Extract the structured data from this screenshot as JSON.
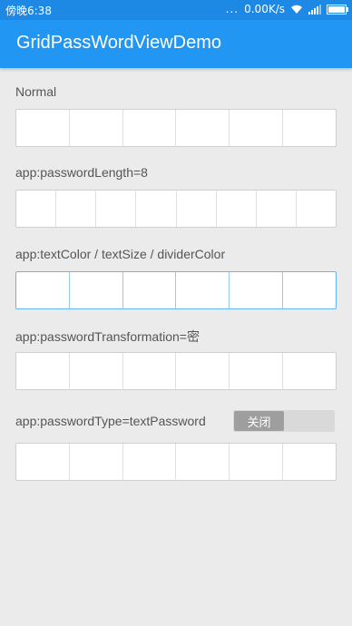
{
  "status_bar": {
    "time": "傍晚6:38",
    "dots": "...",
    "network_speed": "0.00K/s"
  },
  "app_bar": {
    "title": "GridPassWordViewDemo"
  },
  "sections": [
    {
      "label": "Normal",
      "cells": 6
    },
    {
      "label": "app:passwordLength=8",
      "cells": 8
    },
    {
      "label": "app:textColor / textSize / dividerColor",
      "cells": 6
    },
    {
      "label": "app:passwordTransformation=密",
      "cells": 6
    },
    {
      "label": "app:passwordType=textPassword",
      "cells": 6
    }
  ],
  "toggle": {
    "label": "关闭",
    "state": "off"
  }
}
